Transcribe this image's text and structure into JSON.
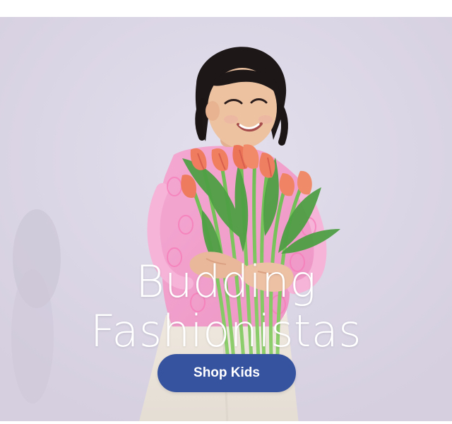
{
  "hero": {
    "headline_line1": "Budding",
    "headline_line2": "Fashionistas",
    "cta_label": "Shop Kids",
    "background_color": "#dcd6e6",
    "cta_color": "#3653a0"
  },
  "image": {
    "subject": "girl-holding-tulips-photo"
  }
}
